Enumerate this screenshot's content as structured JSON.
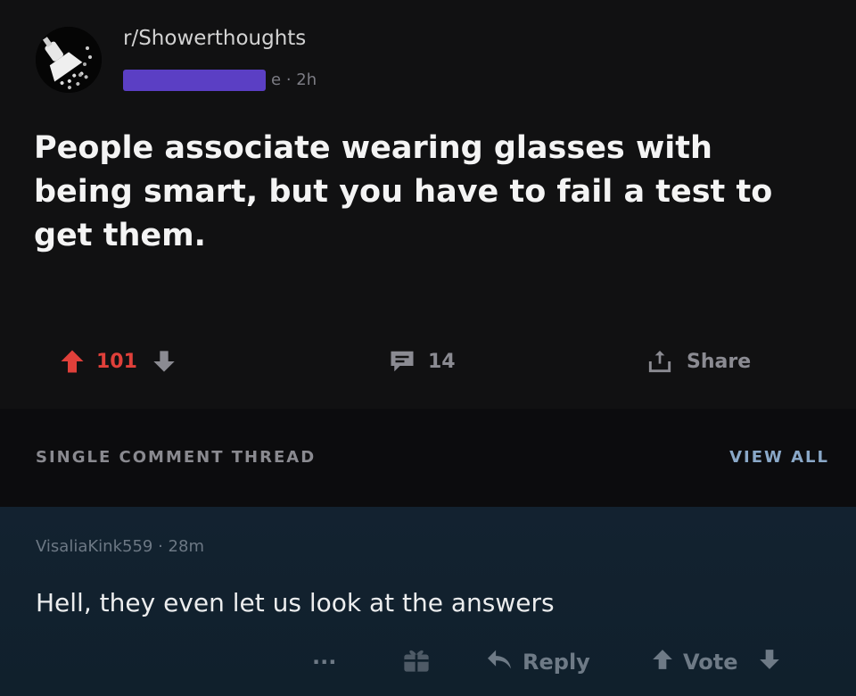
{
  "post": {
    "subreddit": "r/Showerthoughts",
    "author_tail": "e",
    "age": "· 2h",
    "title": "People associate wearing glasses with being smart, but you have to fail a test to get them.",
    "upvotes": "101",
    "comments": "14",
    "share_label": "Share"
  },
  "thread": {
    "label": "SINGLE COMMENT THREAD",
    "view_all": "VIEW ALL"
  },
  "comment": {
    "author": "VisaliaKink559",
    "age": "· 28m",
    "body": "Hell, they even let us look at the answers",
    "more": "···",
    "reply_label": "Reply",
    "vote_label": "Vote"
  },
  "colors": {
    "upvote_accent": "#e0403a",
    "redaction": "#5b3fc4",
    "comment_bg": "#132230",
    "link": "#8aa8c8"
  }
}
